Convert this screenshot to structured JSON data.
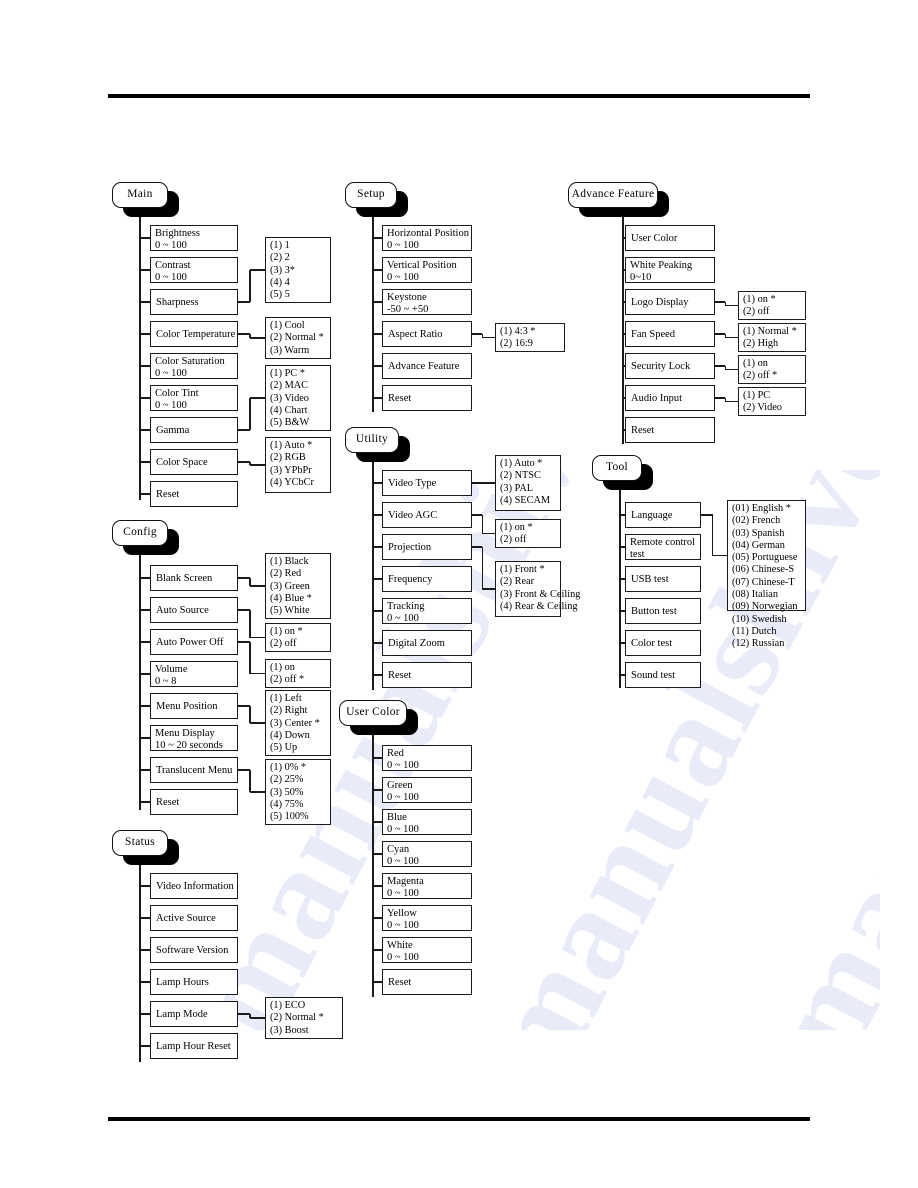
{
  "page": {
    "watermark": "manualshive.com"
  },
  "menus": [
    {
      "id": "main",
      "tab": "Main",
      "items": [
        {
          "label": "Brightness",
          "range": "0 ~ 100"
        },
        {
          "label": "Contrast",
          "range": "0 ~ 100"
        },
        {
          "label": "Sharpness",
          "range": ""
        },
        {
          "label": "Color Temperature",
          "range": ""
        },
        {
          "label": "Color Saturation",
          "range": "0 ~ 100"
        },
        {
          "label": "Color Tint",
          "range": "0 ~ 100"
        },
        {
          "label": "Gamma",
          "range": ""
        },
        {
          "label": "Color Space",
          "range": ""
        },
        {
          "label": "Reset",
          "range": ""
        }
      ],
      "options": [
        {
          "for": "Sharpness",
          "choices": [
            "(1) 1",
            "(2) 2",
            "(3) 3*",
            "(4) 4",
            "(5) 5"
          ]
        },
        {
          "for": "Color Temperature",
          "choices": [
            "(1) Cool",
            "(2) Normal *",
            "(3) Warm"
          ]
        },
        {
          "for": "Gamma",
          "choices": [
            "(1) PC *",
            "(2) MAC",
            "(3) Video",
            "(4) Chart",
            "(5) B&W"
          ]
        },
        {
          "for": "Color Space",
          "choices": [
            "(1) Auto *",
            "(2) RGB",
            "(3) YPbPr",
            "(4) YCbCr"
          ]
        }
      ]
    },
    {
      "id": "config",
      "tab": "Config",
      "items": [
        {
          "label": "Blank Screen",
          "range": ""
        },
        {
          "label": "Auto Source",
          "range": ""
        },
        {
          "label": "Auto Power Off",
          "range": ""
        },
        {
          "label": "Volume",
          "range": "0 ~ 8"
        },
        {
          "label": "Menu Position",
          "range": ""
        },
        {
          "label": "Menu Display",
          "range": "10 ~ 20 seconds"
        },
        {
          "label": "Translucent Menu",
          "range": ""
        },
        {
          "label": "Reset",
          "range": ""
        }
      ],
      "options": [
        {
          "for": "Blank Screen",
          "choices": [
            "(1) Black",
            "(2) Red",
            "(3) Green",
            "(4) Blue *",
            "(5) White"
          ]
        },
        {
          "for": "Auto Source",
          "choices": [
            "(1) on *",
            "(2) off"
          ]
        },
        {
          "for": "Auto Power Off",
          "choices": [
            "(1) on",
            "(2) off *"
          ]
        },
        {
          "for": "Menu Position",
          "choices": [
            "(1) Left",
            "(2) Right",
            "(3) Center *",
            "(4) Down",
            "(5) Up"
          ]
        },
        {
          "for": "Translucent Menu",
          "choices": [
            "(1) 0% *",
            "(2) 25%",
            "(3) 50%",
            "(4) 75%",
            "(5) 100%"
          ]
        }
      ]
    },
    {
      "id": "status",
      "tab": "Status",
      "items": [
        {
          "label": "Video Information",
          "range": ""
        },
        {
          "label": "Active Source",
          "range": ""
        },
        {
          "label": "Software Version",
          "range": ""
        },
        {
          "label": "Lamp Hours",
          "range": ""
        },
        {
          "label": "Lamp Mode",
          "range": ""
        },
        {
          "label": "Lamp Hour Reset",
          "range": ""
        }
      ],
      "options": [
        {
          "for": "Lamp Mode",
          "choices": [
            "(1) ECO",
            "(2) Normal *",
            "(3) Boost"
          ]
        }
      ]
    },
    {
      "id": "setup",
      "tab": "Setup",
      "items": [
        {
          "label": "Horizontal Position",
          "range": "0 ~ 100"
        },
        {
          "label": "Vertical Position",
          "range": " 0 ~ 100"
        },
        {
          "label": "Keystone",
          "range": "-50 ~ +50"
        },
        {
          "label": "Aspect Ratio",
          "range": ""
        },
        {
          "label": "Advance Feature",
          "range": ""
        },
        {
          "label": "Reset",
          "range": ""
        }
      ],
      "options": [
        {
          "for": "Aspect Ratio",
          "choices": [
            "(1) 4:3 *",
            "(2) 16:9"
          ]
        }
      ]
    },
    {
      "id": "utility",
      "tab": "Utility",
      "items": [
        {
          "label": "Video Type",
          "range": ""
        },
        {
          "label": "Video AGC",
          "range": ""
        },
        {
          "label": "Projection",
          "range": ""
        },
        {
          "label": "Frequency",
          "range": ""
        },
        {
          "label": "Tracking",
          "range": "0 ~ 100"
        },
        {
          "label": "Digital Zoom",
          "range": ""
        },
        {
          "label": "Reset",
          "range": ""
        }
      ],
      "options": [
        {
          "for": "Video Type",
          "choices": [
            "(1) Auto *",
            "(2) NTSC",
            "(3) PAL",
            "(4) SECAM"
          ]
        },
        {
          "for": "Video AGC",
          "choices": [
            "(1) on *",
            "(2) off"
          ]
        },
        {
          "for": "Projection",
          "choices": [
            "(1) Front *",
            "(2) Rear",
            "(3) Front & Ceiling",
            "(4) Rear & Ceiling"
          ]
        }
      ]
    },
    {
      "id": "usercolor",
      "tab": "User Color",
      "items": [
        {
          "label": "Red",
          "range": "0 ~ 100"
        },
        {
          "label": "Green",
          "range": "0 ~ 100"
        },
        {
          "label": "Blue",
          "range": "0 ~ 100"
        },
        {
          "label": "Cyan",
          "range": "0 ~ 100"
        },
        {
          "label": "Magenta",
          "range": "0 ~ 100"
        },
        {
          "label": "Yellow",
          "range": "0 ~ 100"
        },
        {
          "label": "White",
          "range": "0 ~ 100"
        },
        {
          "label": "Reset",
          "range": ""
        }
      ],
      "options": []
    },
    {
      "id": "advance",
      "tab": "Advance Feature",
      "items": [
        {
          "label": "User Color",
          "range": ""
        },
        {
          "label": "White Peaking",
          "range": "0~10"
        },
        {
          "label": "Logo Display",
          "range": ""
        },
        {
          "label": "Fan Speed",
          "range": ""
        },
        {
          "label": "Security Lock",
          "range": ""
        },
        {
          "label": "Audio Input",
          "range": ""
        },
        {
          "label": "Reset",
          "range": ""
        }
      ],
      "options": [
        {
          "for": "Logo Display",
          "choices": [
            "(1) on *",
            "(2) off"
          ]
        },
        {
          "for": "Fan Speed",
          "choices": [
            "(1) Normal *",
            "(2) High"
          ]
        },
        {
          "for": "Security Lock",
          "choices": [
            "(1) on",
            "(2) off *"
          ]
        },
        {
          "for": "Audio Input",
          "choices": [
            "(1) PC",
            "(2) Video"
          ]
        }
      ]
    },
    {
      "id": "tool",
      "tab": "Tool",
      "items": [
        {
          "label": "Language",
          "range": ""
        },
        {
          "label": "Remote control",
          "range": "test"
        },
        {
          "label": "USB test",
          "range": ""
        },
        {
          "label": "Button  test",
          "range": ""
        },
        {
          "label": "Color  test",
          "range": ""
        },
        {
          "label": "Sound  test",
          "range": ""
        }
      ],
      "options": [
        {
          "for": "Language",
          "choices": [
            "(01) English *",
            "(02) French",
            "(03) Spanish",
            "(04) German",
            "(05) Portuguese",
            "(06) Chinese-S",
            "(07) Chinese-T",
            "(08) Italian",
            "(09) Norwegian",
            "(10) Swedish",
            "(11) Dutch",
            "(12) Russian"
          ]
        }
      ]
    }
  ]
}
